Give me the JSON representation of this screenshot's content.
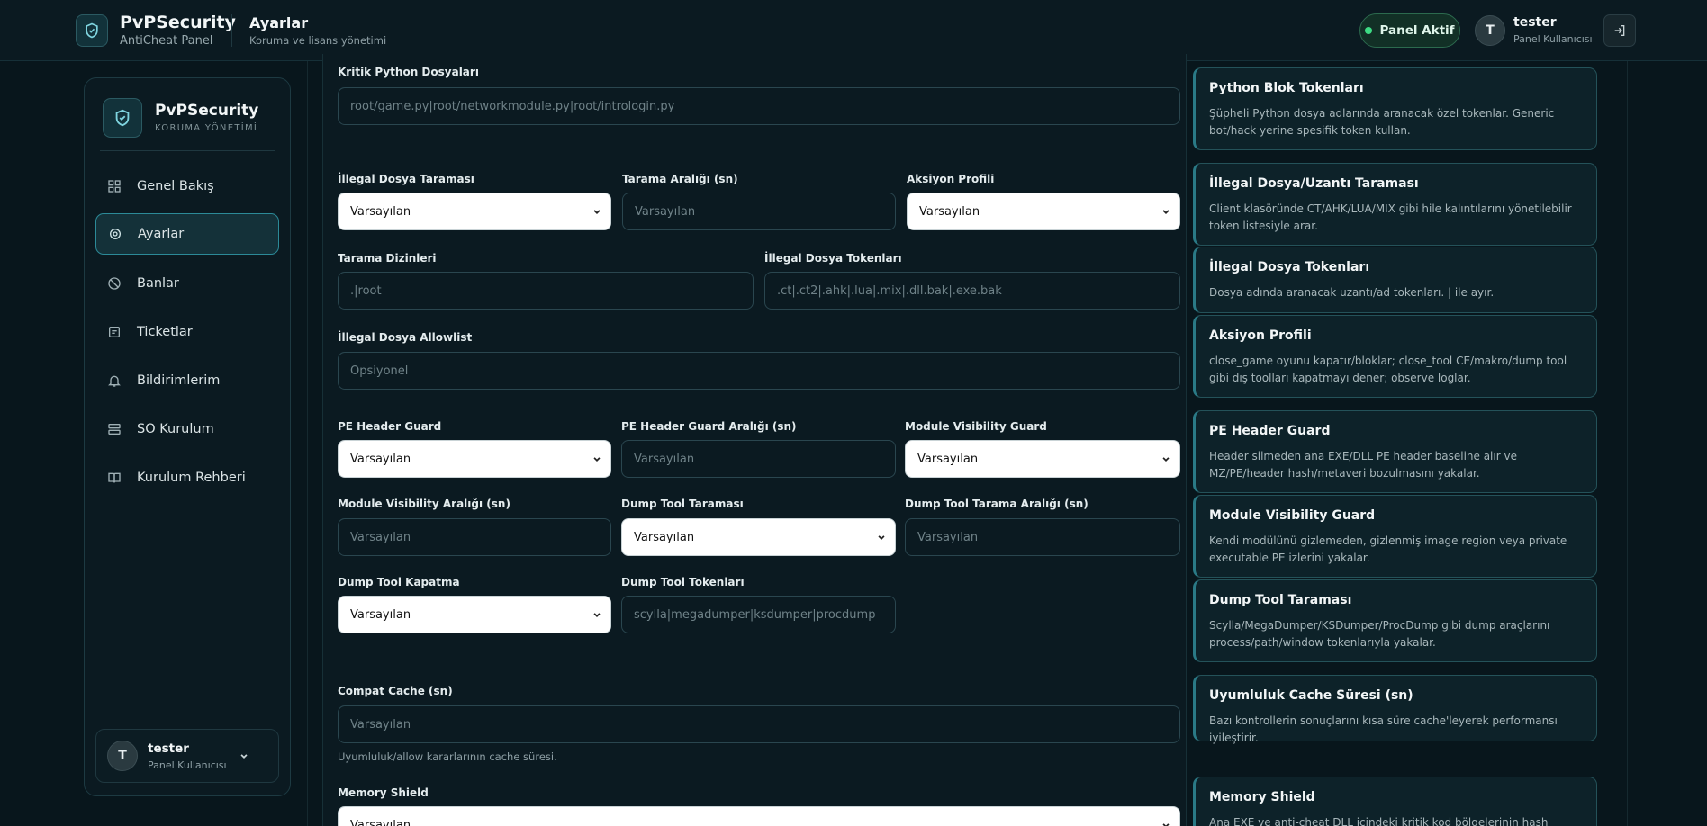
{
  "header": {
    "brand_title": "PvPSecurity",
    "brand_subtitle": "AntiCheat Panel",
    "page_title": "Ayarlar",
    "page_subtitle": "Koruma ve lisans yönetimi",
    "status_label": "Panel Aktif",
    "user_initial": "T",
    "user_name": "tester",
    "user_role": "Panel Kullanıcısı"
  },
  "sidebar": {
    "title": "PvPSecurity",
    "subtitle": "KORUMA YÖNETİMİ",
    "items": [
      {
        "label": "Genel Bakış",
        "icon": "dashboard-icon"
      },
      {
        "label": "Ayarlar",
        "icon": "settings-icon",
        "active": true
      },
      {
        "label": "Banlar",
        "icon": "ban-icon"
      },
      {
        "label": "Ticketlar",
        "icon": "ticket-icon"
      },
      {
        "label": "Bildirimlerim",
        "icon": "bell-icon"
      },
      {
        "label": "SO Kurulum",
        "icon": "server-icon"
      },
      {
        "label": "Kurulum Rehberi",
        "icon": "book-icon"
      }
    ],
    "user": {
      "initial": "T",
      "name": "tester",
      "role": "Panel Kullanıcısı"
    }
  },
  "form": {
    "kritik_python": {
      "label": "Kritik Python Dosyaları",
      "placeholder": "root/game.py|root/networkmodule.py|root/intrologin.py"
    },
    "illegal_tarama": {
      "label": "İllegal Dosya Taraması",
      "value": "Varsayılan"
    },
    "tarama_araligi": {
      "label": "Tarama Aralığı (sn)",
      "placeholder": "Varsayılan"
    },
    "aksiyon_profili": {
      "label": "Aksiyon Profili",
      "value": "Varsayılan"
    },
    "tarama_dizinleri": {
      "label": "Tarama Dizinleri",
      "placeholder": ".|root"
    },
    "illegal_tokenlar": {
      "label": "İllegal Dosya Tokenları",
      "placeholder": ".ct|.ct2|.ahk|.lua|.mix|.dll.bak|.exe.bak"
    },
    "illegal_allowlist": {
      "label": "İllegal Dosya Allowlist",
      "placeholder": "Opsiyonel"
    },
    "pe_header_guard": {
      "label": "PE Header Guard",
      "value": "Varsayılan"
    },
    "pe_header_araligi": {
      "label": "PE Header Guard Aralığı (sn)",
      "placeholder": "Varsayılan"
    },
    "module_visibility": {
      "label": "Module Visibility Guard",
      "value": "Varsayılan"
    },
    "module_visibility_araligi": {
      "label": "Module Visibility Aralığı (sn)",
      "placeholder": "Varsayılan"
    },
    "dump_tool_taramasi": {
      "label": "Dump Tool Taraması",
      "value": "Varsayılan"
    },
    "dump_tool_araligi": {
      "label": "Dump Tool Tarama Aralığı (sn)",
      "placeholder": "Varsayılan"
    },
    "dump_tool_kapatma": {
      "label": "Dump Tool Kapatma",
      "value": "Varsayılan"
    },
    "dump_tool_tokenlari": {
      "label": "Dump Tool Tokenları",
      "placeholder": "scylla|megadumper|ksdumper|procdump"
    },
    "compat_cache": {
      "label": "Compat Cache (sn)",
      "placeholder": "Varsayılan",
      "help": "Uyumluluk/allow kararlarının cache süresi."
    },
    "memory_shield": {
      "label": "Memory Shield",
      "value": "Varsayılan"
    }
  },
  "cards": [
    {
      "title": "Python Blok Tokenları",
      "desc": "Şüpheli Python dosya adlarında aranacak özel tokenlar. Generic bot/hack yerine spesifik token kullan."
    },
    {
      "title": "İllegal Dosya/Uzantı Taraması",
      "desc": "Client klasöründe CT/AHK/LUA/MIX gibi hile kalıntılarını yönetilebilir token listesiyle arar."
    },
    {
      "title": "İllegal Dosya Tokenları",
      "desc": "Dosya adında aranacak uzantı/ad tokenları. | ile ayır."
    },
    {
      "title": "Aksiyon Profili",
      "desc": "close_game oyunu kapatır/bloklar; close_tool CE/makro/dump tool gibi dış toolları kapatmayı dener; observe loglar."
    },
    {
      "title": "PE Header Guard",
      "desc": "Header silmeden ana EXE/DLL PE header baseline alır ve MZ/PE/header hash/metaveri bozulmasını yakalar."
    },
    {
      "title": "Module Visibility Guard",
      "desc": "Kendi modülünü gizlemeden, gizlenmiş image region veya private executable PE izlerini yakalar."
    },
    {
      "title": "Dump Tool Taraması",
      "desc": "Scylla/MegaDumper/KSDumper/ProcDump gibi dump araçlarını process/path/window tokenlarıyla yakalar."
    },
    {
      "title": "Uyumluluk Cache Süresi (sn)",
      "desc": "Bazı kontrollerin sonuçlarını kısa süre cache'leyerek performansı iyileştirir."
    },
    {
      "title": "Memory Shield",
      "desc": "Ana EXE ve anti-cheat DLL içindeki kritik kod bölgelerinin hash bütünlüğünü"
    }
  ],
  "colors": {
    "accent": "#2c8a98",
    "status": "#3ddc84",
    "background": "#08161c"
  }
}
